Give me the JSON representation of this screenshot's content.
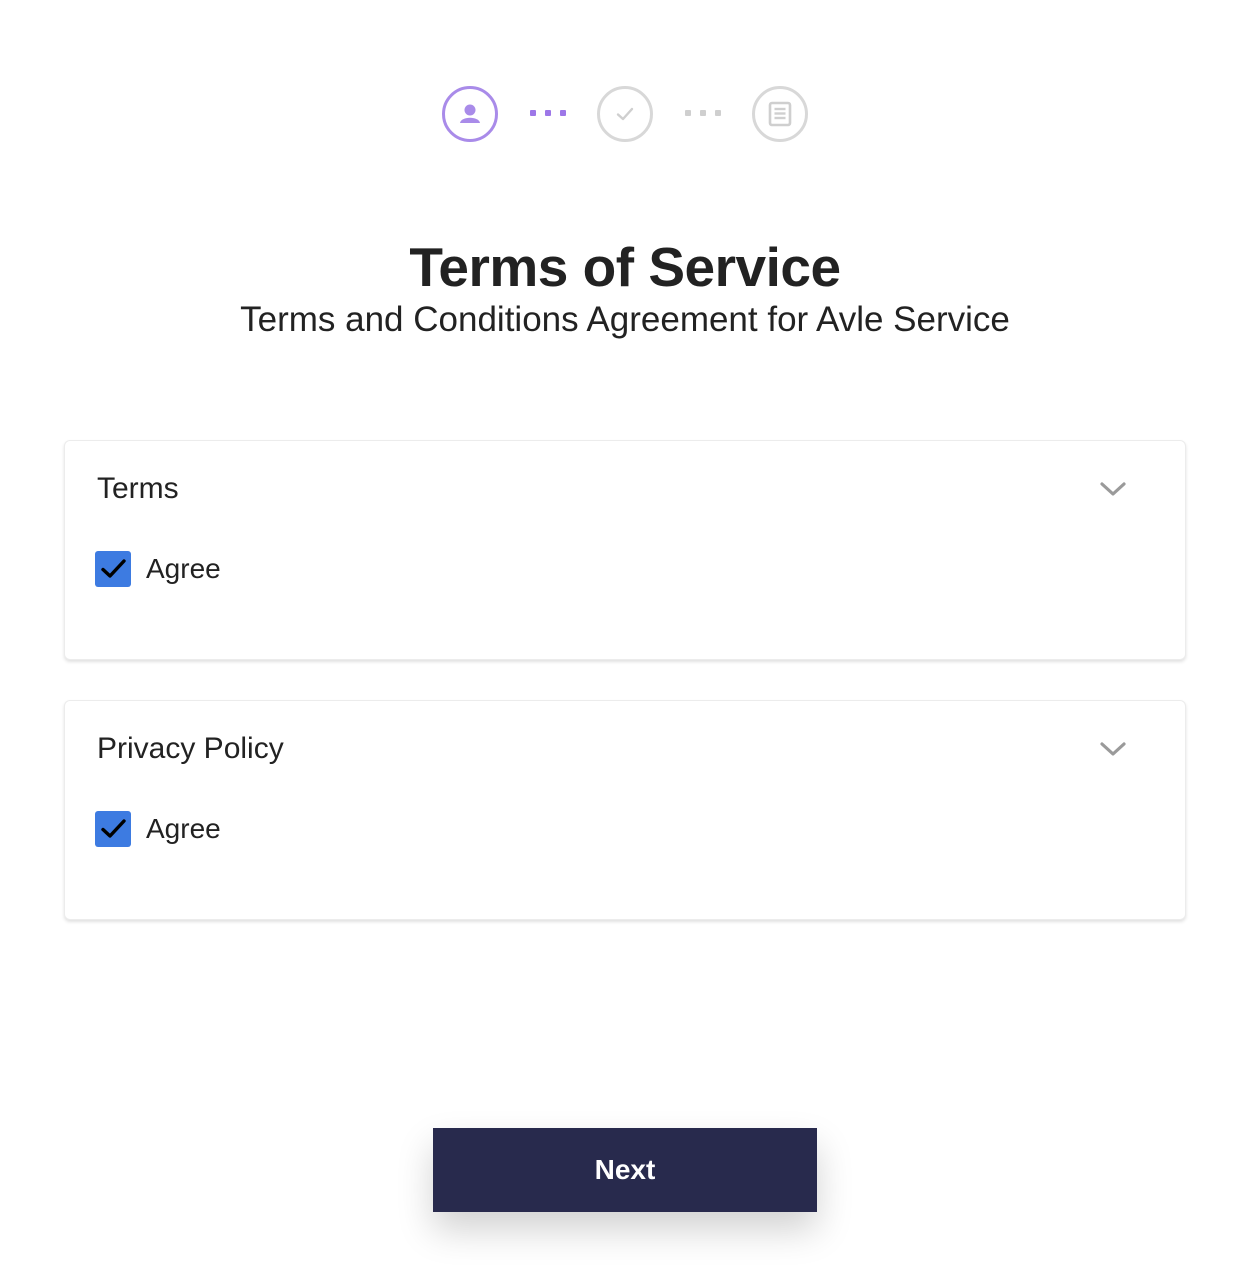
{
  "stepper": {
    "steps": [
      {
        "icon": "user-icon",
        "state": "active"
      },
      {
        "icon": "check-icon",
        "state": "inactive"
      },
      {
        "icon": "document-icon",
        "state": "inactive"
      }
    ],
    "active_color": "#a98be9",
    "inactive_color": "#d8d8d8"
  },
  "header": {
    "title": "Terms of Service",
    "subtitle": "Terms and Conditions Agreement for Avle Service"
  },
  "sections": [
    {
      "title": "Terms",
      "agree_label": "Agree",
      "checked": true
    },
    {
      "title": "Privacy Policy",
      "agree_label": "Agree",
      "checked": true
    }
  ],
  "colors": {
    "checkbox": "#3d7be1",
    "button": "#282a4d"
  },
  "actions": {
    "next_label": "Next"
  }
}
